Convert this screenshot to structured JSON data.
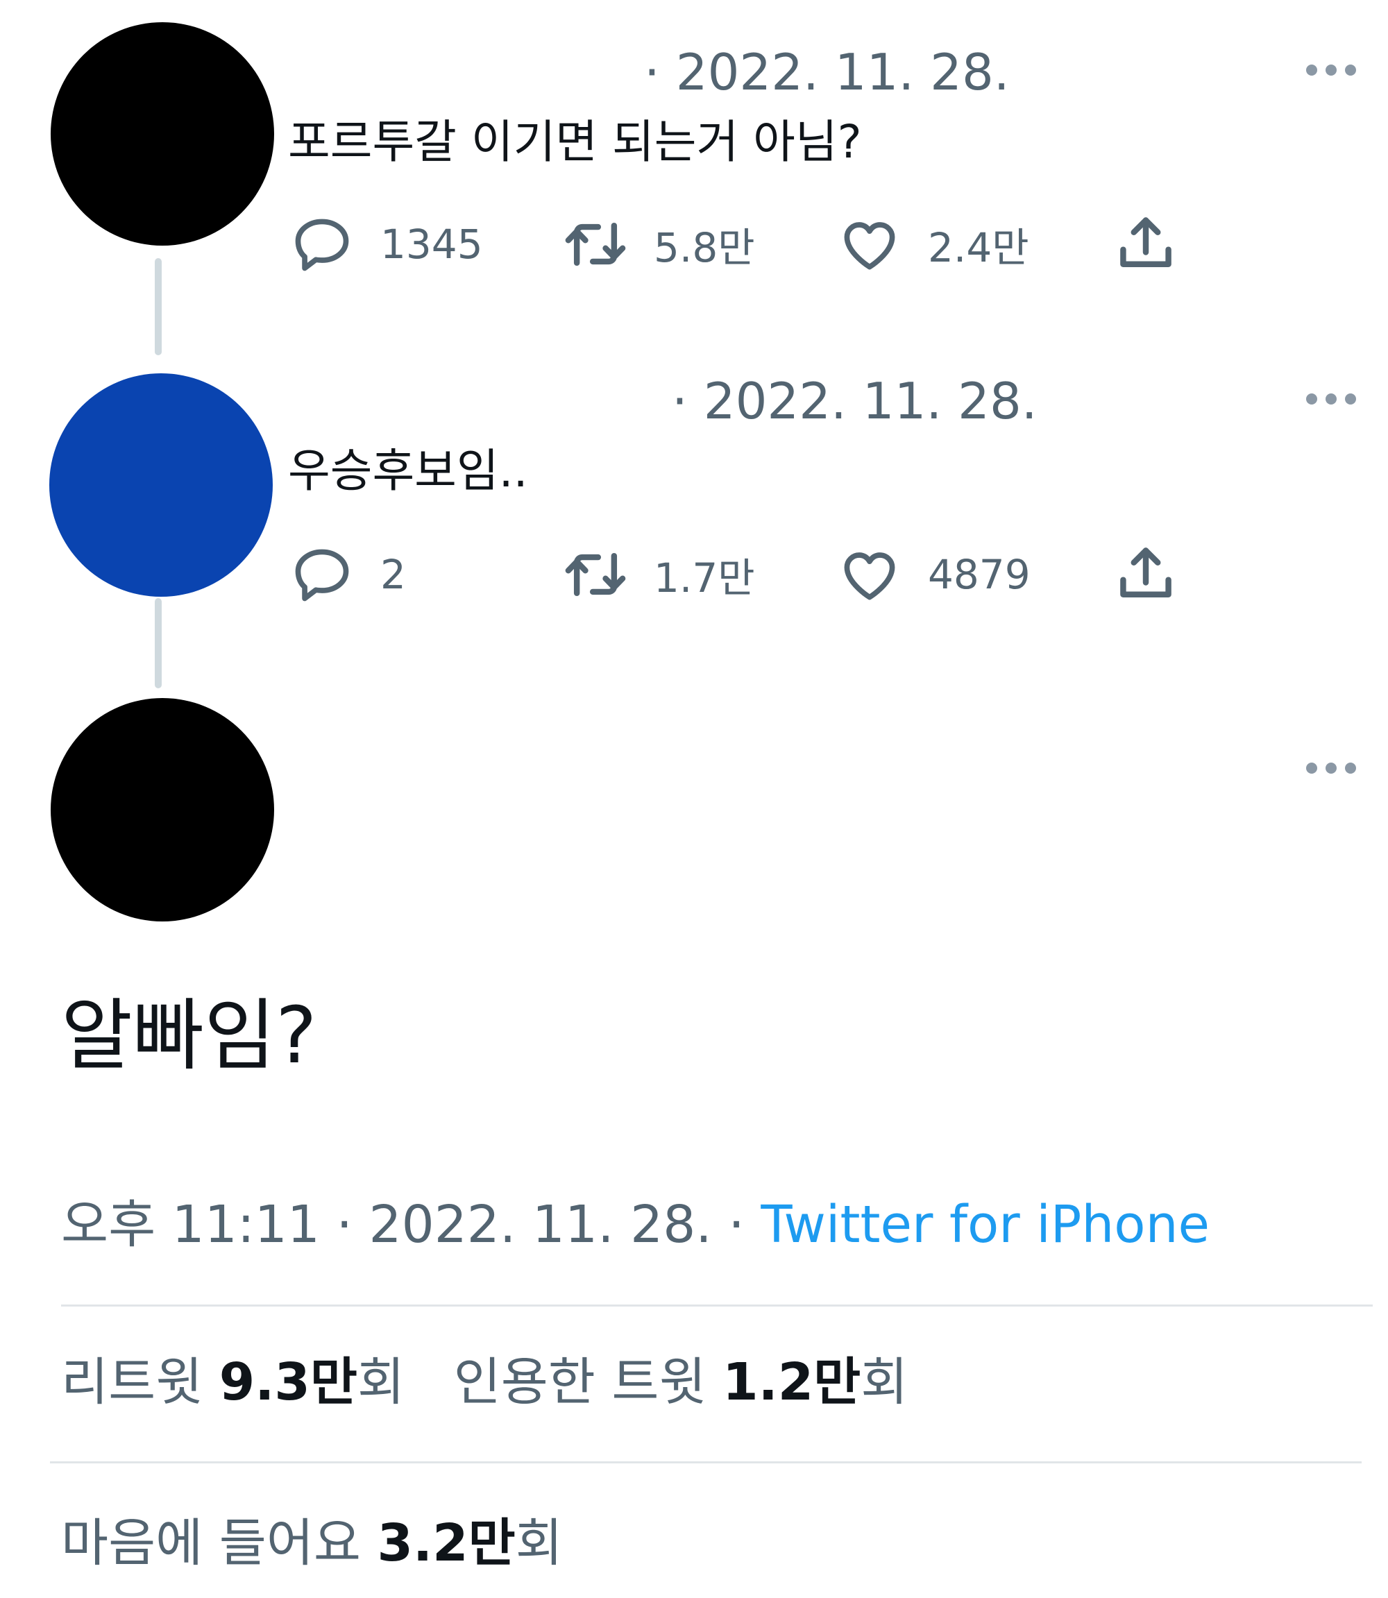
{
  "thread": [
    {
      "avatar_color": "#000000",
      "date": "· 2022. 11. 28.",
      "text": "포르투갈 이기면 되는거 아님?",
      "replies": "1345",
      "retweets": "5.8만",
      "likes": "2.4만"
    },
    {
      "avatar_color": "#0a44b0",
      "date": "· 2022. 11. 28.",
      "text": "우승후보임..",
      "replies": "2",
      "retweets": "1.7만",
      "likes": "4879"
    }
  ],
  "main_tweet": {
    "avatar_color": "#000000",
    "text": "알빠임?",
    "time": "오후 11:11",
    "sep1": "·",
    "date": "2022. 11. 28.",
    "sep2": "·",
    "source": "Twitter for iPhone"
  },
  "stats": {
    "retweets_label": "리트윗",
    "retweets_value": "9.3만",
    "retweets_unit": "회",
    "quotes_label": "인용한 트윗",
    "quotes_value": "1.2만",
    "quotes_unit": "회",
    "likes_label": "마음에 들어요",
    "likes_value": "3.2만",
    "likes_unit": "회"
  },
  "colors": {
    "muted": "#536471",
    "link": "#1d9bf0",
    "divider": "#e1e5e8"
  },
  "icons": [
    "reply-icon",
    "retweet-icon",
    "like-icon",
    "share-icon",
    "more-icon"
  ]
}
